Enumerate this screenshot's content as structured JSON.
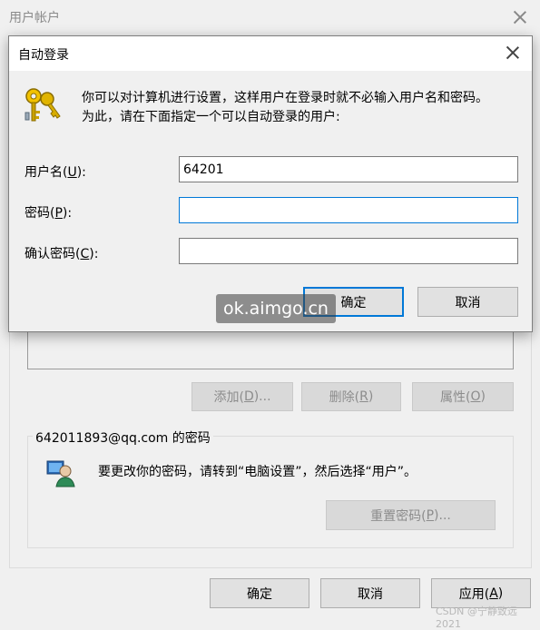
{
  "back_window": {
    "title": "用户帐户",
    "buttons": {
      "add": "添加(",
      "add_key": "D",
      "add_suffix": ")...",
      "remove": "删除(",
      "remove_key": "R",
      "remove_suffix": ")",
      "properties": "属性(",
      "properties_key": "O",
      "properties_suffix": ")"
    },
    "password_group": {
      "title": "642011893@qq.com 的密码",
      "message": "要更改你的密码，请转到“电脑设置”，然后选择“用户”。",
      "reset_button": "重置密码(",
      "reset_key": "P",
      "reset_suffix": ")..."
    },
    "footer": {
      "ok": "确定",
      "cancel": "取消",
      "apply": "应用(",
      "apply_key": "A",
      "apply_suffix": ")"
    }
  },
  "dialog": {
    "title": "自动登录",
    "description_line1": "你可以对计算机进行设置，这样用户在登录时就不必输入用户名和密码。",
    "description_line2": "为此，请在下面指定一个可以自动登录的用户:",
    "fields": [
      {
        "label": "用户名(",
        "key": "U",
        "suffix": "):",
        "value": "64201"
      },
      {
        "label": "密码(",
        "key": "P",
        "suffix": "):",
        "value": ""
      },
      {
        "label": "确认密码(",
        "key": "C",
        "suffix": "):",
        "value": ""
      }
    ],
    "ok": "确定",
    "cancel": "取消"
  },
  "watermark": "ok.aimgo.cn",
  "csdn_watermark": "CSDN @宁静致远2021"
}
